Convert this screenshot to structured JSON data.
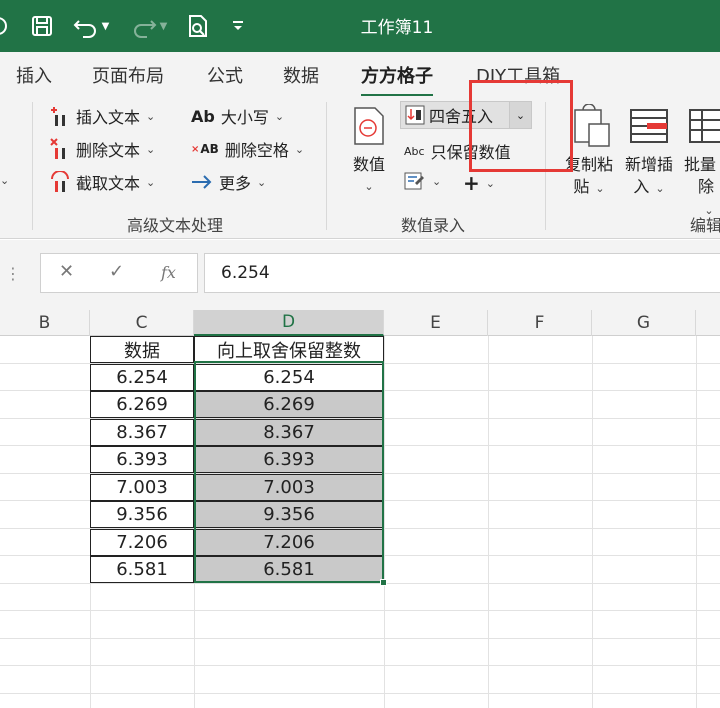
{
  "window": {
    "title": "工作簿11"
  },
  "tabs": [
    "插入",
    "页面布局",
    "公式",
    "数据",
    "方方格子",
    "DIY工具箱"
  ],
  "active_tab": "方方格子",
  "ribbon": {
    "text_group": {
      "insert_text": "插入文本",
      "delete_text": "删除文本",
      "extract_text": "截取文本",
      "case": "大小写",
      "delete_spaces": "删除空格",
      "more": "更多",
      "label": "高级文本处理"
    },
    "value_group": {
      "value_btn": "数值",
      "round_select": "四舍五入",
      "keep_value": "只保留数值",
      "label": "数值录入"
    },
    "edit_group": {
      "copy_paste_line1": "复制粘",
      "copy_paste_line2": "贴",
      "insert_new_line1": "新增插",
      "insert_new_line2": "入",
      "batch_delete_line1": "批量",
      "batch_delete_line2": "除",
      "label": "编辑"
    },
    "icon_labels": {
      "case_ab": "Ab",
      "spaces_ab": "AB",
      "abc": "Abc"
    }
  },
  "formula_bar": {
    "value": "6.254",
    "fx": "fx"
  },
  "columns": [
    "B",
    "C",
    "D",
    "E",
    "F",
    "G"
  ],
  "selected_column": "D",
  "table": {
    "headers": [
      "数据",
      "向上取舍保留整数"
    ],
    "rows": [
      [
        "6.254",
        "6.254"
      ],
      [
        "6.269",
        "6.269"
      ],
      [
        "8.367",
        "8.367"
      ],
      [
        "6.393",
        "6.393"
      ],
      [
        "7.003",
        "7.003"
      ],
      [
        "9.356",
        "9.356"
      ],
      [
        "7.206",
        "7.206"
      ],
      [
        "6.581",
        "6.581"
      ]
    ]
  },
  "colors": {
    "accent": "#217346",
    "highlight": "#e53935",
    "selection_fill": "#c9c9c9"
  }
}
